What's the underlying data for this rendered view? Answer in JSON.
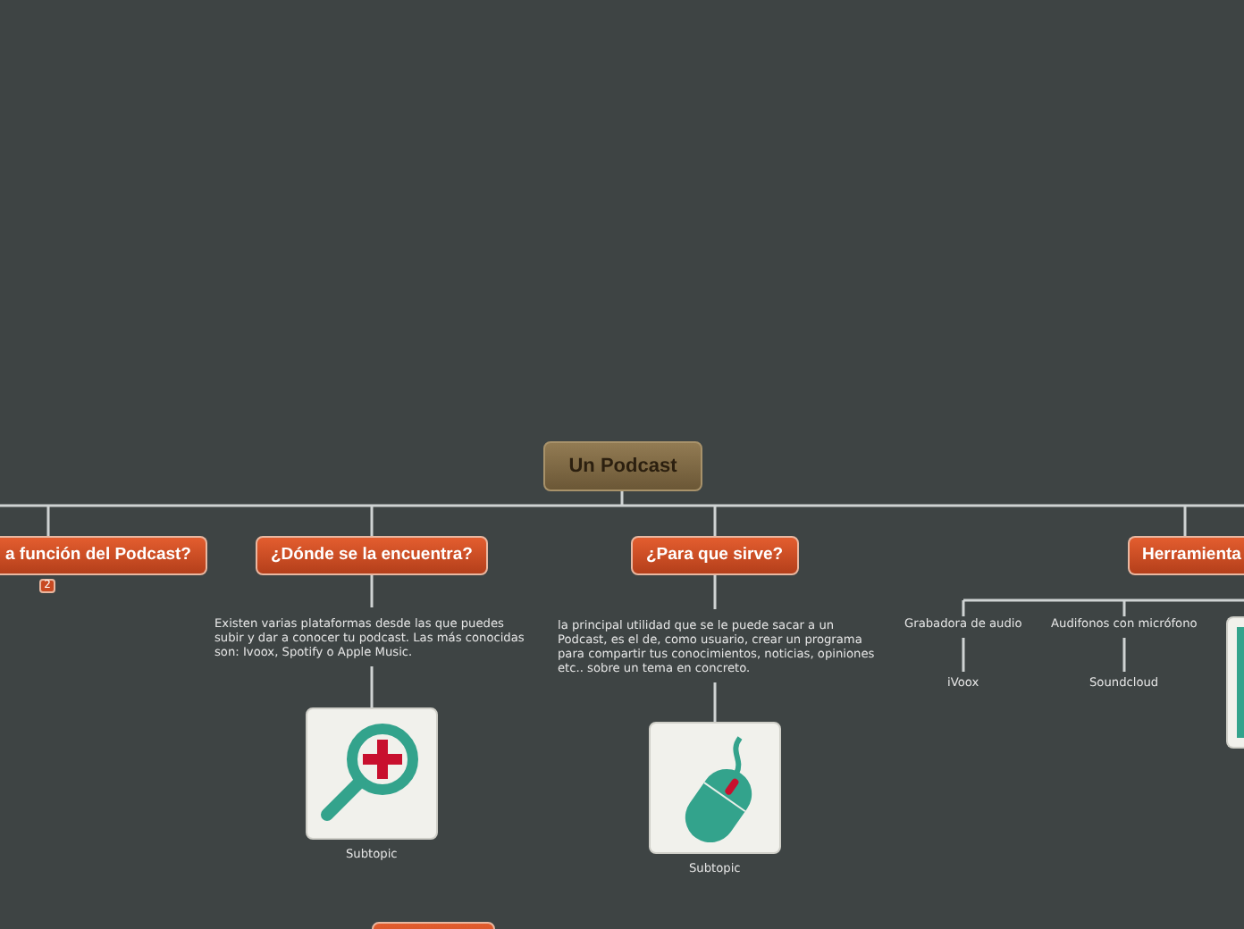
{
  "central": {
    "label": "Un Podcast"
  },
  "topics": [
    {
      "label": "a función del Podcast?",
      "badge": "2"
    },
    {
      "label": "¿Dónde se la encuentra?",
      "note": "Existen varias plataformas desde las que puedes subir y dar a conocer tu podcast. Las más conocidas son: Ivoox, Spotify o Apple Music.",
      "image": {
        "kind": "magnifier",
        "caption": "Subtopic"
      }
    },
    {
      "label": "¿Para que sirve?",
      "note": "la principal utilidad que se le puede sacar a un Podcast, es el de, como usuario, crear un programa para compartir tus conocimientos, noticias, opiniones etc.. sobre un tema en concreto.",
      "image": {
        "kind": "mouse",
        "caption": "Subtopic"
      }
    },
    {
      "label": "Herramienta",
      "subtopics": [
        {
          "label": "Grabadora de audio",
          "children": [
            {
              "label": "iVoox"
            }
          ]
        },
        {
          "label": "Audifonos con micrófono",
          "children": [
            {
              "label": "Soundcloud"
            }
          ]
        }
      ]
    }
  ]
}
